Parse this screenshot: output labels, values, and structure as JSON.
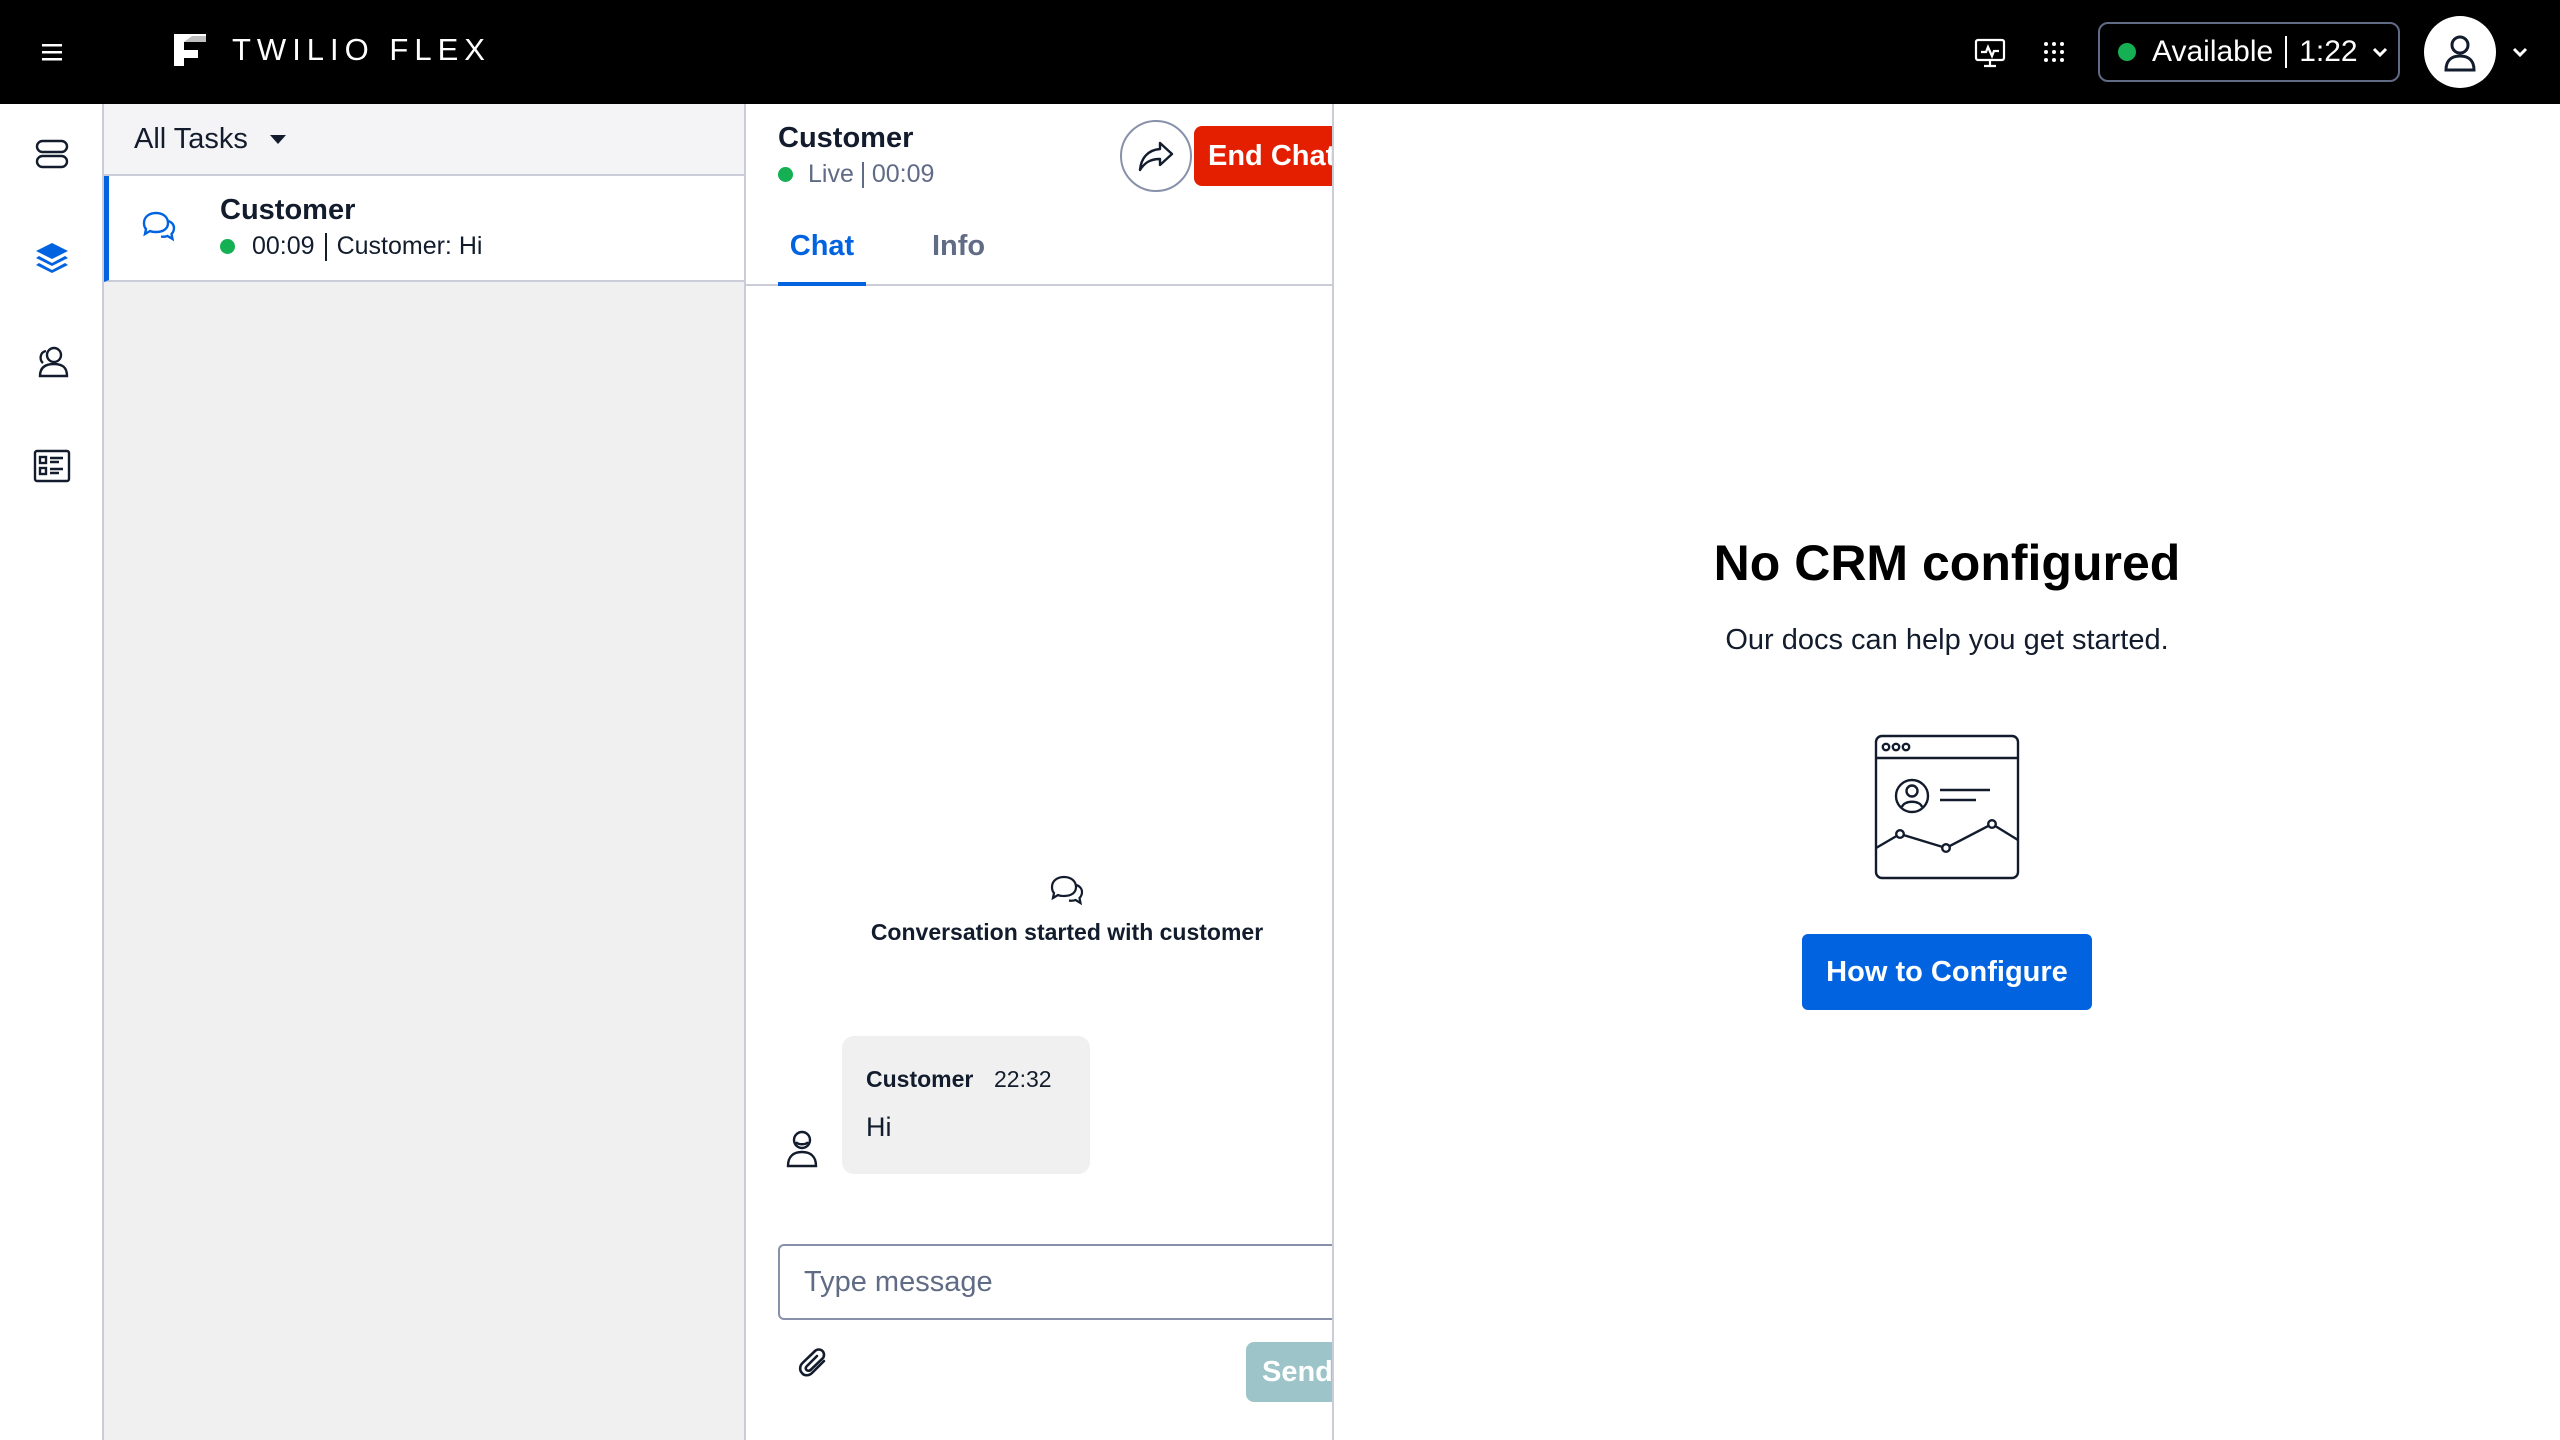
{
  "topbar": {
    "brand": "TWILIO FLEX",
    "status": {
      "label": "Available",
      "timer": "1:22",
      "color": "#14b053"
    }
  },
  "task_list": {
    "filter_label": "All Tasks",
    "tasks": [
      {
        "title": "Customer",
        "time": "00:09",
        "preview": "Customer: Hi"
      }
    ]
  },
  "chat": {
    "title": "Customer",
    "status_label": "Live",
    "duration": "00:09",
    "end_button": "End Chat",
    "tabs": [
      "Chat",
      "Info"
    ],
    "conversation_start": "Conversation started with customer",
    "messages": [
      {
        "author": "Customer",
        "time": "22:32",
        "text": "Hi"
      }
    ],
    "input_placeholder": "Type message",
    "send_button": "Send"
  },
  "crm": {
    "title": "No CRM configured",
    "subtitle": "Our docs can help you get started.",
    "button": "How to Configure"
  },
  "colors": {
    "accent": "#0263e0",
    "danger": "#e31f00",
    "online": "#14b053"
  },
  "icons": [
    "menu-icon",
    "twilio-flex-logo",
    "monitor-icon",
    "apps-grid-icon",
    "user-icon",
    "chevron-down-icon",
    "agent-desktop-icon",
    "layers-icon",
    "teams-icon",
    "queue-stats-icon",
    "chat-bubbles-icon",
    "transfer-icon",
    "paperclip-icon",
    "crm-illustration"
  ]
}
